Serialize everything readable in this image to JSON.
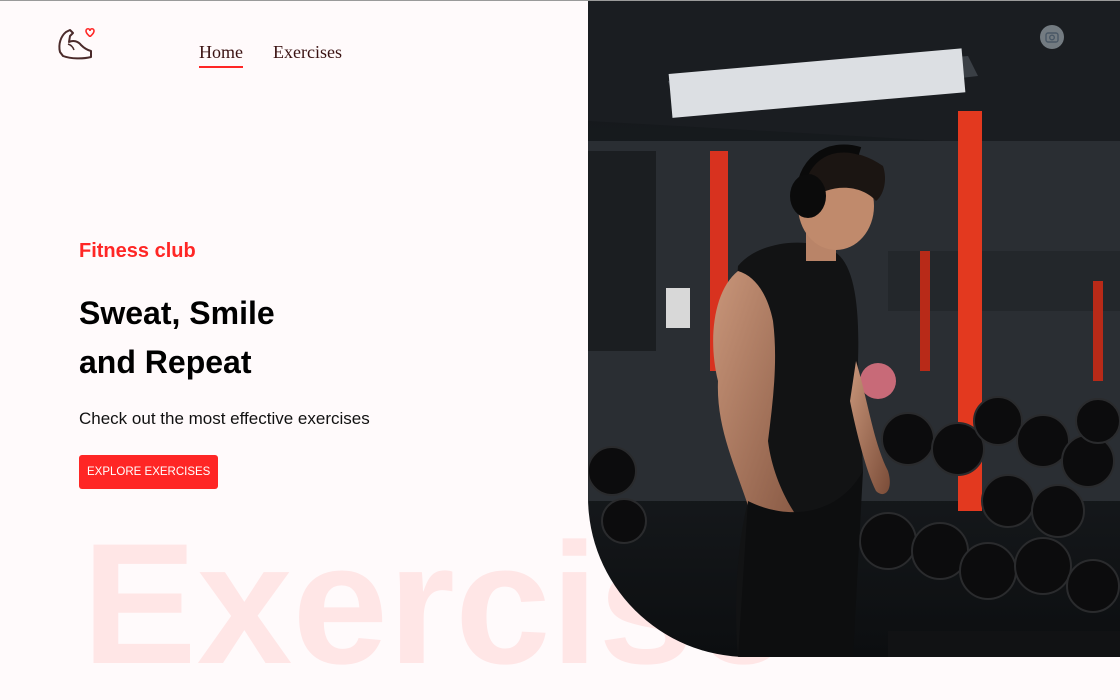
{
  "nav": {
    "items": [
      {
        "label": "Home",
        "active": true
      },
      {
        "label": "Exercises",
        "active": false
      }
    ]
  },
  "hero": {
    "kicker": "Fitness club",
    "headline_line1": "Sweat, Smile",
    "headline_line2": "and Repeat",
    "subtext": "Check out the most effective exercises",
    "cta_label": "EXPLORE EXERCISES"
  },
  "watermark": "Exercise",
  "icons": {
    "logo": "flexed-arm-heart-icon",
    "camera": "camera-icon"
  },
  "colors": {
    "accent": "#ff2625",
    "background": "#fffafb",
    "text": "#000000"
  }
}
